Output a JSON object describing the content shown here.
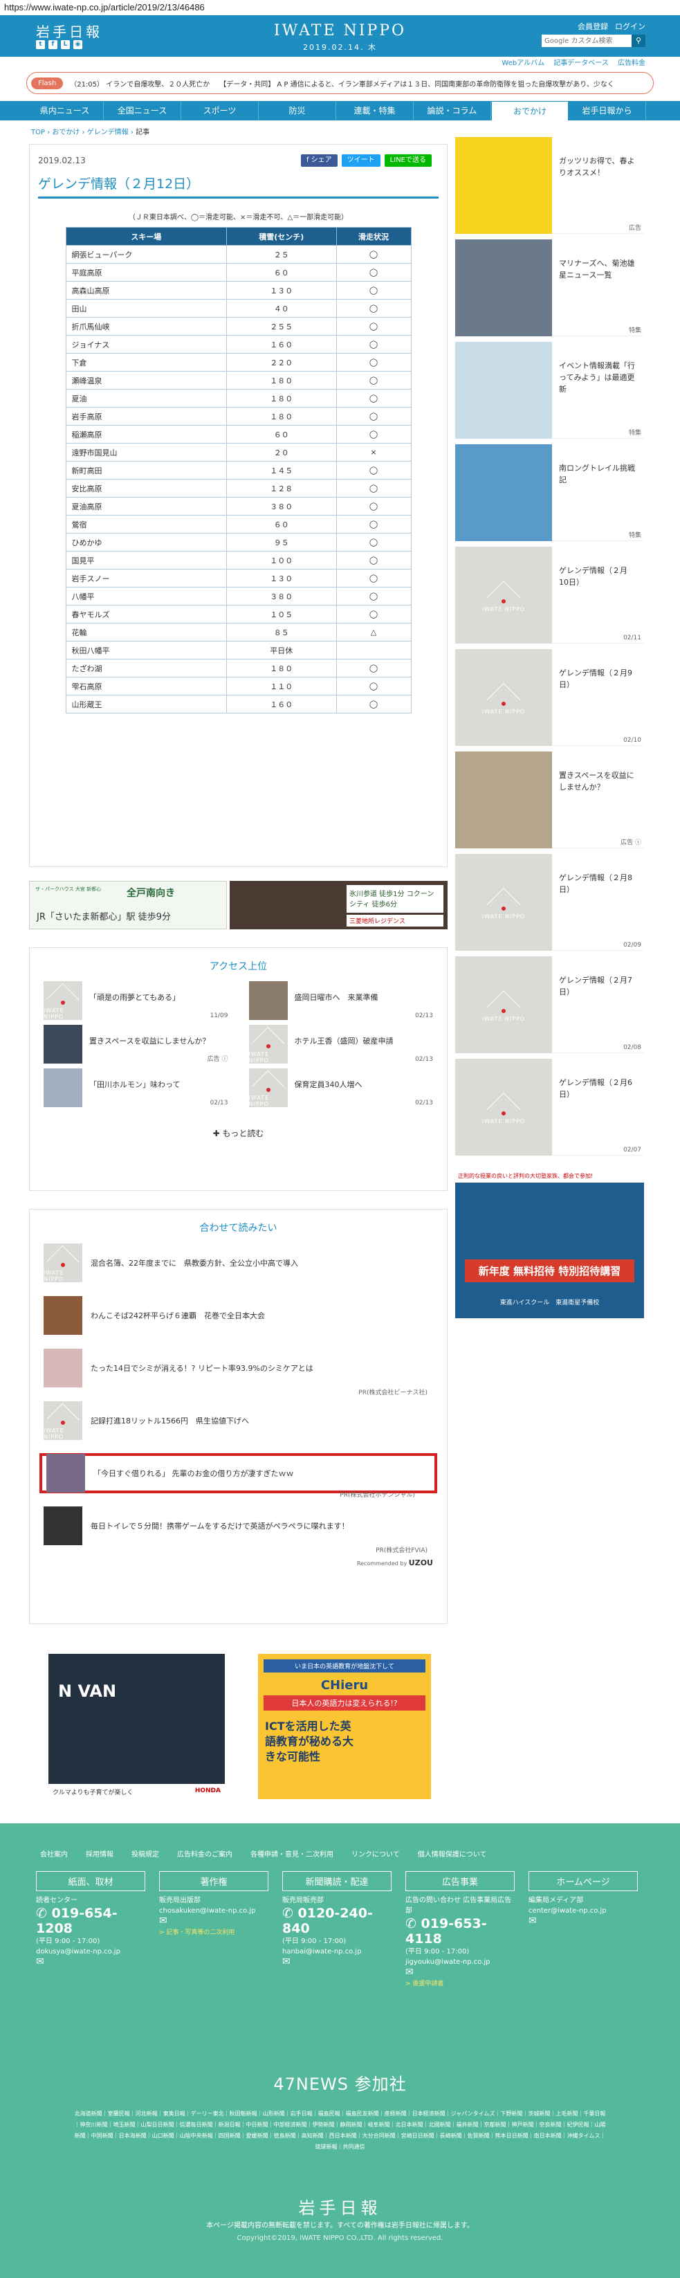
{
  "url": "https://www.iwate-np.co.jp/article/2019/2/13/46486",
  "header": {
    "logo_jp": "岩手日報",
    "logo_en": "IWATE NIPPO",
    "date": "2019.02.14. 木",
    "member_register": "会員登録",
    "login": "ログイン",
    "search_placeholder": "Google カスタム検索",
    "sub_links": [
      "Webアルバム",
      "記事データベース",
      "広告料金"
    ]
  },
  "flash": {
    "label": "Flash",
    "items": [
      "（21:05） イランで自爆攻撃、２０人死亡か",
      "【データ・共同】 A P 通信によると、イラン軍部メディアは１３日、同国南東部の革命防衛隊を狙った自爆攻撃があり、少なく"
    ]
  },
  "nav": [
    "県内ニュース",
    "全国ニュース",
    "スポーツ",
    "防災",
    "連載・特集",
    "論説・コラム",
    "おでかけ",
    "岩手日報から"
  ],
  "breadcrumb": [
    "TOP",
    "おでかけ",
    "ゲレンデ情報",
    "記事"
  ],
  "article": {
    "date": "2019.02.13",
    "share": [
      "f シェア",
      "ツイート",
      "LINEで送る"
    ],
    "title": "ゲレンデ情報（２月12日）",
    "note": "（ＪＲ東日本調べ、◯＝滑走可能、×＝滑走不可、△＝一部滑走可能）",
    "columns": [
      "スキー場",
      "積雪(センチ)",
      "滑走状況"
    ],
    "rows": [
      [
        "網張ビューパーク",
        "２５",
        "◯"
      ],
      [
        "平庭高原",
        "６０",
        "◯"
      ],
      [
        "高森山高原",
        "１３０",
        "◯"
      ],
      [
        "田山",
        "４０",
        "◯"
      ],
      [
        "折爪馬仙峡",
        "２５５",
        "◯"
      ],
      [
        "ジョイナス",
        "１６０",
        "◯"
      ],
      [
        "下倉",
        "２２０",
        "◯"
      ],
      [
        "瀬峰温泉",
        "１８０",
        "◯"
      ],
      [
        "夏油",
        "１８０",
        "◯"
      ],
      [
        "岩手高原",
        "１８０",
        "◯"
      ],
      [
        "稲瀬高原",
        "６０",
        "◯"
      ],
      [
        "遠野市国見山",
        "２０",
        "×"
      ],
      [
        "新町高田",
        "１４５",
        "◯"
      ],
      [
        "安比高原",
        "１２８",
        "◯"
      ],
      [
        "夏油高原",
        "３８０",
        "◯"
      ],
      [
        "鶯宿",
        "６０",
        "◯"
      ],
      [
        "ひめかゆ",
        "９５",
        "◯"
      ],
      [
        "国見平",
        "１００",
        "◯"
      ],
      [
        "岩手スノー",
        "１３０",
        "◯"
      ],
      [
        "八幡平",
        "３８０",
        "◯"
      ],
      [
        "春ヤモルズ",
        "１０５",
        "◯"
      ],
      [
        "花輪",
        "８５",
        "△"
      ],
      [
        "秋田八幡平",
        "平日休",
        ""
      ],
      [
        "たざわ湖",
        "１８０",
        "◯"
      ],
      [
        "雫石高原",
        "１１０",
        "◯"
      ],
      [
        "山形蔵王",
        "１６０",
        "◯"
      ]
    ]
  },
  "ads": {
    "banner_left": "JR「さいたま新都心」駅 徒歩9分",
    "banner_left_sub": "全戸南向き",
    "banner_left_brand": "ザ・パークハウス 大宮 新都心",
    "banner_right": "氷川参道 徒歩1分 コクーンシティ 徒歩6分",
    "banner_right_brand": "三菱地所レジデンス",
    "bottom_left": "N VAN",
    "bottom_left_sub": "クルマよりも子育てが楽しく",
    "bottom_left_brand": "HONDA",
    "bottom_right_head": "いま日本の英語教育が地盤沈下して",
    "bottom_right_q": "日本人の英語力は変えられる!?",
    "bottom_right_main": "ICTを活用した英語教育が秘める大きな可能性",
    "bottom_right_brand": "CHieru",
    "side_tag": "正則的な授業の良いと評判の大切塾家族、都会で参加!",
    "side_title": "新年度 無料招待 特別招待講習",
    "side_sub": "東進ハイスクール　東進衛星予備校"
  },
  "access": {
    "title": "アクセス上位",
    "items": [
      {
        "title": "「頑是の雨夢とてもある」",
        "date": "11/09"
      },
      {
        "title": "盛岡日曜市へ　来業準備",
        "date": "02/13"
      },
      {
        "title": "置きスペースを収益にしませんか？",
        "date": "広告 ⓘ"
      },
      {
        "title": "ホテル王香（盛岡）破産申請",
        "date": "02/13"
      },
      {
        "title": "「田川ホルモン」味わって",
        "date": "02/13"
      },
      {
        "title": "保育定員340人増へ",
        "date": "02/13"
      }
    ],
    "more": "✚ もっと読む"
  },
  "related": {
    "title": "合わせて読みたい",
    "items": [
      {
        "title": "混合名簿、22年度までに　県教委方針、全公立小中高で導入",
        "pr": ""
      },
      {
        "title": "わんこそば242杯平らげ６連覇　花巻で全日本大会",
        "pr": ""
      },
      {
        "title": "たった14日でシミが消える！? リピート率93.9%のシミケアとは",
        "pr": "PR(株式会社ビーナス社)"
      },
      {
        "title": "記録打進18リットル1566円　県生協値下げへ",
        "pr": ""
      },
      {
        "title": "「今日すぐ借りれる」 先輩のお金の借り方が凄すぎたｗｗ",
        "pr": "PR(株式会社ポテンシャル)"
      },
      {
        "title": "毎日トイレで５分間！携帯ゲームをするだけで英語がペラペラに喋れます！",
        "pr": "PR(株式会社FVIA)"
      }
    ],
    "recommended": "Recommended by"
  },
  "sidebar": [
    {
      "title": "ガッツリお得で、春よりオススメ！",
      "date": "広告"
    },
    {
      "title": "マリナーズへ、菊池雄星ニュース一覧",
      "date": "特集"
    },
    {
      "title": "イベント情報満載「行ってみよう」は最適更新",
      "date": "特集"
    },
    {
      "title": "南ロングトレイル挑戦記",
      "date": "特集"
    },
    {
      "title": "ゲレンデ情報（２月10日）",
      "date": "02/11"
    },
    {
      "title": "ゲレンデ情報（２月9日）",
      "date": "02/10"
    },
    {
      "title": "置きスペースを収益にしませんか？",
      "date": "広告 ⓘ"
    },
    {
      "title": "ゲレンデ情報（２月8日）",
      "date": "02/09"
    },
    {
      "title": "ゲレンデ情報（２月7日）",
      "date": "02/08"
    },
    {
      "title": "ゲレンデ情報（２月6日）",
      "date": "02/07"
    }
  ],
  "footer": {
    "links": [
      "会社案内",
      "採用情報",
      "投稿規定",
      "広告料金のご案内",
      "各種申請・意見・二次利用",
      "リンクについて",
      "個人情報保護について"
    ],
    "cols": [
      {
        "head": "紙面、取材",
        "label": "読者センター",
        "tel": "019-654-1208",
        "hours": "(平日 9:00 - 17:00)",
        "mail": "dokusya@iwate-np.co.jp",
        "link": ""
      },
      {
        "head": "著作権",
        "label": "販売局出版部",
        "tel": "",
        "hours": "",
        "mail": "chosakuken@iwate-np.co.jp",
        "link": "> 記事・写真等の二次利用"
      },
      {
        "head": "新聞購読・配達",
        "label": "販売局販売部",
        "tel": "0120-240-840",
        "hours": "(平日 9:00 - 17:00)",
        "mail": "hanbai@iwate-np.co.jp",
        "link": ""
      },
      {
        "head": "広告事業",
        "label": "広告の問い合わせ 広告事業局広告部",
        "tel": "019-653-4118",
        "hours": "(平日 9:00 - 17:00)",
        "mail": "jigyouku@iwate-np.co.jp",
        "link": "> 後援申請書"
      },
      {
        "head": "ホームページ",
        "label": "編集局メディア部",
        "tel": "",
        "hours": "",
        "mail": "center@iwate-np.co.jp",
        "link": ""
      }
    ],
    "news47": "47NEWS 参加社",
    "papers": "北海道新聞｜室蘭民報｜河北新報｜東奥日報｜デーリー東北｜秋田魁新報｜山形新聞｜岩手日報｜福島民報｜福島民友新聞｜産経新聞｜日本経済新聞｜ジャパンタイムズ｜下野新聞｜茨城新聞｜上毛新聞｜千葉日報｜神奈川新聞｜埼玉新聞｜山梨日日新聞｜信濃毎日新聞｜新潟日報｜中日新聞｜中部経済新聞｜伊勢新聞｜静岡新聞｜岐阜新聞｜北日本新聞｜北國新聞｜福井新聞｜京都新聞｜神戸新聞｜奈良新聞｜紀伊民報｜山陽新聞｜中国新聞｜日本海新聞｜山口新聞｜山陰中央新報｜四国新聞｜愛媛新聞｜徳島新聞｜高知新聞｜西日本新聞｜大分合同新聞｜宮崎日日新聞｜長崎新聞｜佐賀新聞｜熊本日日新聞｜南日本新聞｜沖縄タイムス｜琉球新報｜共同通信",
    "logo": "岩手日報",
    "notice": "本ページ掲載内容の無断転載を禁じます。すべての著作権は岩手日報社に帰属します。",
    "copyright": "Copyright©2019, IWATE NIPPO CO.,LTD. All rights reserved."
  }
}
